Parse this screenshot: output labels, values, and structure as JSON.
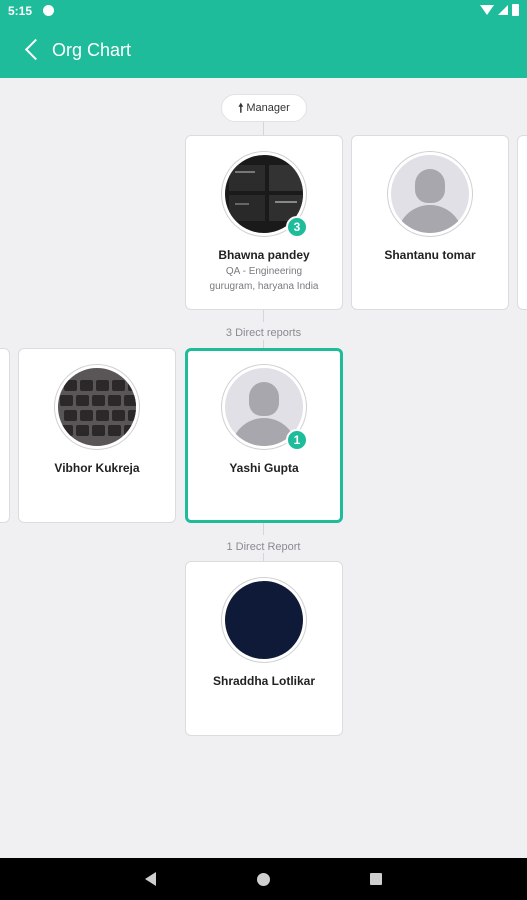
{
  "status_bar": {
    "time": "5:15"
  },
  "app_bar": {
    "title": "Org Chart"
  },
  "manager_pill": {
    "label": "Manager",
    "icon": "arrow-up-icon"
  },
  "managers": [
    {
      "name": "Bhawna pandey",
      "title": "QA - Engineering",
      "location": "gurugram, haryana India",
      "reports_badge": "3",
      "avatar": "photo-dark"
    },
    {
      "name": "Shantanu tomar",
      "avatar": "placeholder"
    }
  ],
  "direct_reports_label": "3 Direct reports",
  "peers": [
    {
      "name": "Vibhor Kukreja",
      "avatar": "photo-keyboard"
    },
    {
      "name": "Yashi Gupta",
      "reports_badge": "1",
      "avatar": "placeholder",
      "selected": true
    }
  ],
  "sub_reports_label": "1 Direct Report",
  "sub_reports": [
    {
      "name": "Shraddha Lotlikar",
      "avatar": "navy"
    }
  ],
  "colors": {
    "accent": "#1fbc9c",
    "background": "#f0f0f3"
  }
}
